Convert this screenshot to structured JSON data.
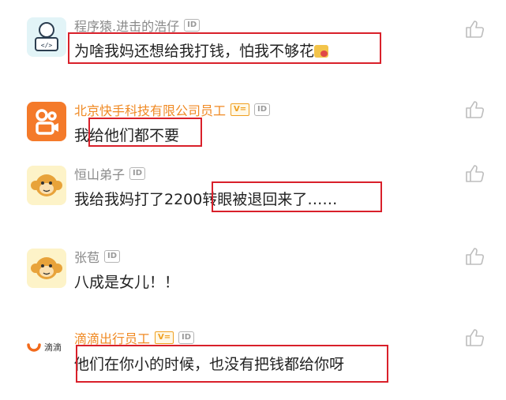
{
  "comments": [
    {
      "name": "程序猿.进击的浩仔",
      "badge_id": "ID",
      "text": "为啥我妈还想给我打钱，怕我不够花"
    },
    {
      "name": "北京快手科技有限公司员工",
      "badge_v": "V=",
      "badge_id": "ID",
      "text": "我给他们都不要"
    },
    {
      "name": "恒山弟子",
      "badge_id": "ID",
      "text": "我给我妈打了2200转眼被退回来了……"
    },
    {
      "name": "张苞",
      "badge_id": "ID",
      "text": "八成是女儿！！"
    },
    {
      "name": "滴滴出行员工",
      "badge_v": "V=",
      "badge_id": "ID",
      "text": "他们在你小的时候，也没有把钱都给你呀",
      "avatar_text": "滴滴"
    }
  ],
  "colors": {
    "highlight_box": "#d9202a",
    "employee_name": "#f08a24"
  },
  "icons": [
    "thumbs-up-icon",
    "coder-avatar",
    "kuaishou-logo",
    "monkey-avatar",
    "didi-logo"
  ]
}
